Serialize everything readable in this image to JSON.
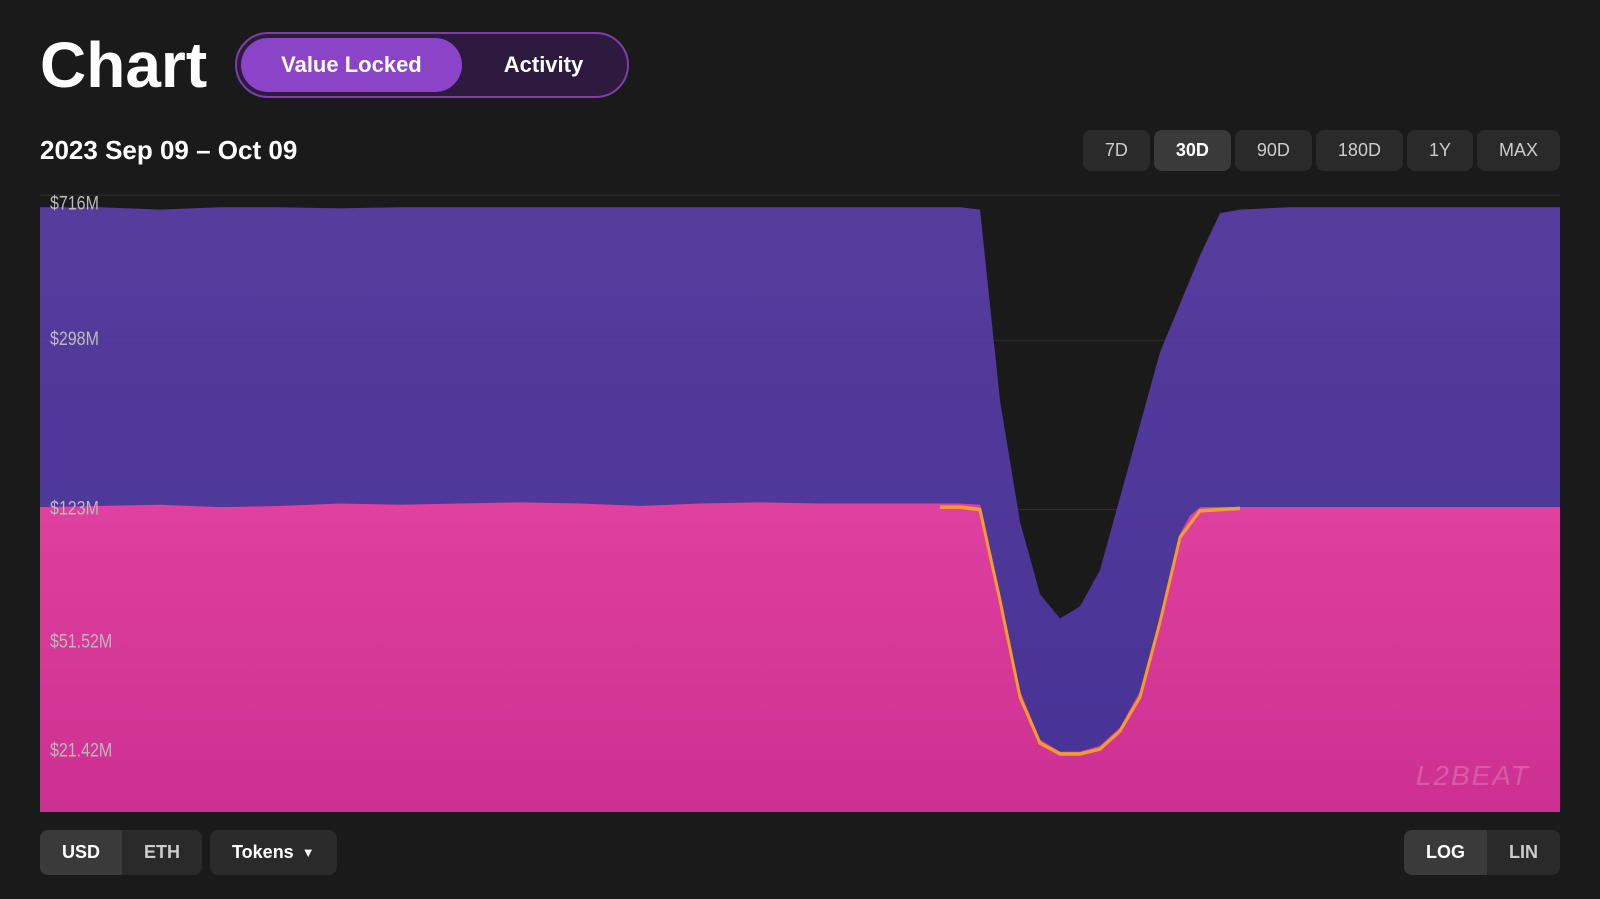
{
  "header": {
    "title": "Chart",
    "tabs": [
      {
        "id": "value-locked",
        "label": "Value Locked",
        "active": true
      },
      {
        "id": "activity",
        "label": "Activity",
        "active": false
      }
    ]
  },
  "dateRange": {
    "label": "2023 Sep 09 – Oct 09"
  },
  "rangeButtons": [
    {
      "id": "7d",
      "label": "7D",
      "active": false
    },
    {
      "id": "30d",
      "label": "30D",
      "active": true
    },
    {
      "id": "90d",
      "label": "90D",
      "active": false
    },
    {
      "id": "180d",
      "label": "180D",
      "active": false
    },
    {
      "id": "1y",
      "label": "1Y",
      "active": false
    },
    {
      "id": "max",
      "label": "MAX",
      "active": false
    }
  ],
  "yAxisLabels": [
    "$716M",
    "$298M",
    "$123M",
    "$51.52M",
    "$21.42M"
  ],
  "watermark": "L2BEAT",
  "bottomControls": {
    "currencyButtons": [
      {
        "id": "usd",
        "label": "USD",
        "active": true
      },
      {
        "id": "eth",
        "label": "ETH",
        "active": false
      }
    ],
    "tokensButton": {
      "label": "Tokens",
      "chevron": "▼"
    },
    "scaleButtons": [
      {
        "id": "log",
        "label": "LOG",
        "active": true
      },
      {
        "id": "lin",
        "label": "LIN",
        "active": false
      }
    ]
  }
}
